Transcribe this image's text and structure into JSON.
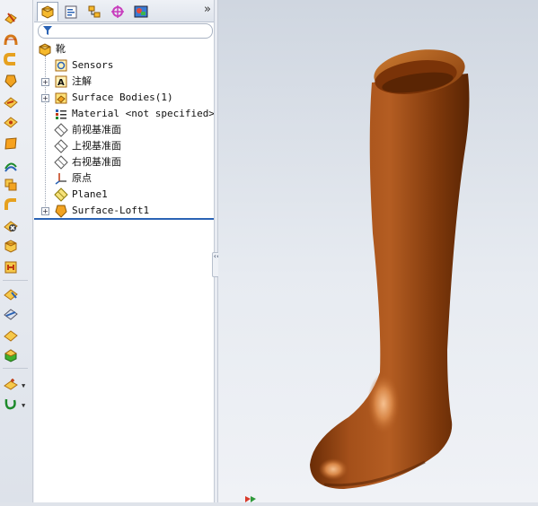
{
  "tabs": [
    {
      "name": "feature-manager",
      "icon": "feature-tree-icon",
      "active": true
    },
    {
      "name": "property-manager",
      "icon": "property-manager-icon",
      "active": false
    },
    {
      "name": "configuration-manager",
      "icon": "configuration-manager-icon",
      "active": false
    },
    {
      "name": "dimxpert-manager",
      "icon": "dimxpert-icon",
      "active": false
    },
    {
      "name": "display-manager",
      "icon": "display-manager-icon",
      "active": false
    }
  ],
  "tabs_more": "»",
  "filter": {
    "placeholder": "",
    "icon": "filter-icon"
  },
  "tree": {
    "root": {
      "label": "靴",
      "icon": "part-icon"
    },
    "items": [
      {
        "label": "Sensors",
        "icon": "sensors-icon",
        "expandable": false
      },
      {
        "label": "注解",
        "icon": "annotations-icon",
        "expandable": true,
        "expander": "+"
      },
      {
        "label": "Surface Bodies(1)",
        "icon": "surface-bodies-icon",
        "expandable": true,
        "expander": "+"
      },
      {
        "label": "Material <not specified>",
        "icon": "material-icon",
        "expandable": false
      },
      {
        "label": "前视基准面",
        "icon": "plane-icon",
        "expandable": false
      },
      {
        "label": "上视基准面",
        "icon": "plane-icon",
        "expandable": false
      },
      {
        "label": "右视基准面",
        "icon": "plane-icon",
        "expandable": false
      },
      {
        "label": "原点",
        "icon": "origin-icon",
        "expandable": false
      },
      {
        "label": "Plane1",
        "icon": "plane-feature-icon",
        "expandable": false
      },
      {
        "label": "Surface-Loft1",
        "icon": "surface-loft-icon",
        "expandable": true,
        "expander": "+"
      }
    ]
  },
  "splitter_handle": "‹‹",
  "toolbar": {
    "tools": [
      "extruded-surface-icon",
      "revolved-surface-icon",
      "swept-surface-icon",
      "lofted-surface-icon",
      "boundary-surface-icon",
      "filled-surface-icon",
      "planar-surface-icon",
      "offset-surface-icon",
      "ruled-surface-icon",
      "radiate-surface-icon",
      "delete-face-icon",
      "replace-face-icon",
      "untrim-surface-icon",
      "surface-fillet-icon",
      "extend-surface-icon",
      "trim-surface-icon",
      "knit-surface-icon",
      "thicken-icon",
      "reference-geometry-icon",
      "curves-icon"
    ],
    "dropdown_arrow": "▼"
  },
  "colors": {
    "model": "#9c4a12",
    "accent": "#2a63b5",
    "highlight": "#f3b27a"
  }
}
